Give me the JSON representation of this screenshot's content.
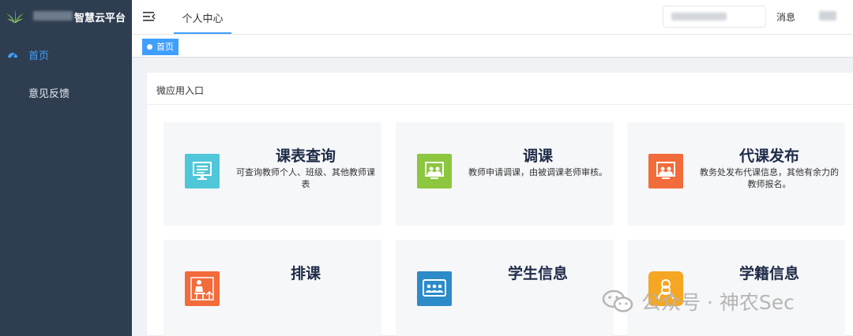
{
  "sidebar": {
    "logo_text": "智慧云平台",
    "items": [
      {
        "label": "首页",
        "icon": "dashboard-icon",
        "active": true
      },
      {
        "label": "意见反馈",
        "icon": "",
        "active": false
      }
    ]
  },
  "header": {
    "tab": "个人中心",
    "messages": "消息"
  },
  "tags": [
    {
      "label": "首页"
    }
  ],
  "section": {
    "title": "微应用入口",
    "tiles": [
      {
        "title": "课表查询",
        "desc": "可查询教师个人、班级、其他教师课表",
        "icon": "timetable-icon",
        "color": "#4fc7d8"
      },
      {
        "title": "调课",
        "desc": "教师申请调课，由被调课老师审核。",
        "icon": "class-swap-icon",
        "color": "#8dc63f"
      },
      {
        "title": "代课发布",
        "desc": "教务处发布代课信息，其他有余力的教师报名。",
        "icon": "substitute-icon",
        "color": "#f26b3a"
      },
      {
        "title": "排课",
        "desc": "",
        "icon": "scheduling-icon",
        "color": "#f26b3a"
      },
      {
        "title": "学生信息",
        "desc": "",
        "icon": "students-icon",
        "color": "#2c8bc9"
      },
      {
        "title": "学籍信息",
        "desc": "",
        "icon": "student-record-icon",
        "color": "#f5a623"
      }
    ]
  },
  "watermark": "公众号 · 神农Sec",
  "colors": {
    "sidebar_bg": "#2e3d50",
    "accent": "#409eff"
  }
}
